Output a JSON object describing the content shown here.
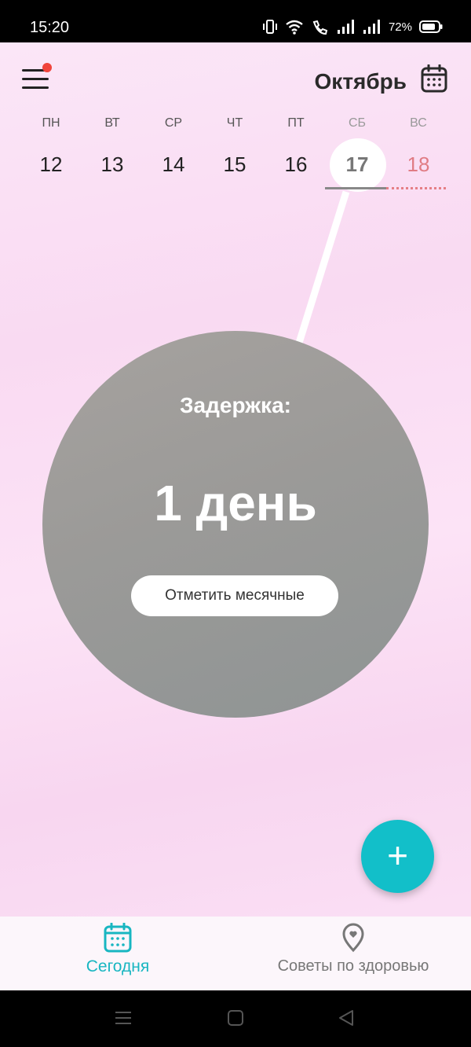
{
  "status_bar": {
    "time": "15:20",
    "battery_percent": "72%",
    "icons": [
      "vibrate-icon",
      "wifi-icon",
      "wifi-calling-icon",
      "signal-icon",
      "signal-icon",
      "battery-icon"
    ]
  },
  "header": {
    "menu_icon": "hamburger-menu-icon",
    "has_notification_dot": true,
    "month": "Октябрь",
    "calendar_icon": "calendar-icon"
  },
  "week": {
    "days": [
      {
        "weekday": "ПН",
        "date": "12"
      },
      {
        "weekday": "ВТ",
        "date": "13"
      },
      {
        "weekday": "СР",
        "date": "14"
      },
      {
        "weekday": "ЧТ",
        "date": "15"
      },
      {
        "weekday": "ПТ",
        "date": "16"
      },
      {
        "weekday": "СБ",
        "date": "17"
      },
      {
        "weekday": "ВС",
        "date": "18"
      }
    ],
    "selected_date": "17"
  },
  "cycle": {
    "label": "Задержка:",
    "value": "1 день",
    "action_label": "Отметить месячные"
  },
  "fab": {
    "label": "+",
    "icon": "plus-icon"
  },
  "bottom_nav": {
    "items": [
      {
        "label": "Сегодня",
        "icon": "calendar-icon",
        "active": true
      },
      {
        "label": "Советы по здоровью",
        "icon": "location-heart-icon",
        "active": false
      }
    ]
  },
  "colors": {
    "accent": "#12bfc9",
    "circle": "#9b9a98",
    "sunday": "#e07c84",
    "notification": "#f0443b"
  }
}
